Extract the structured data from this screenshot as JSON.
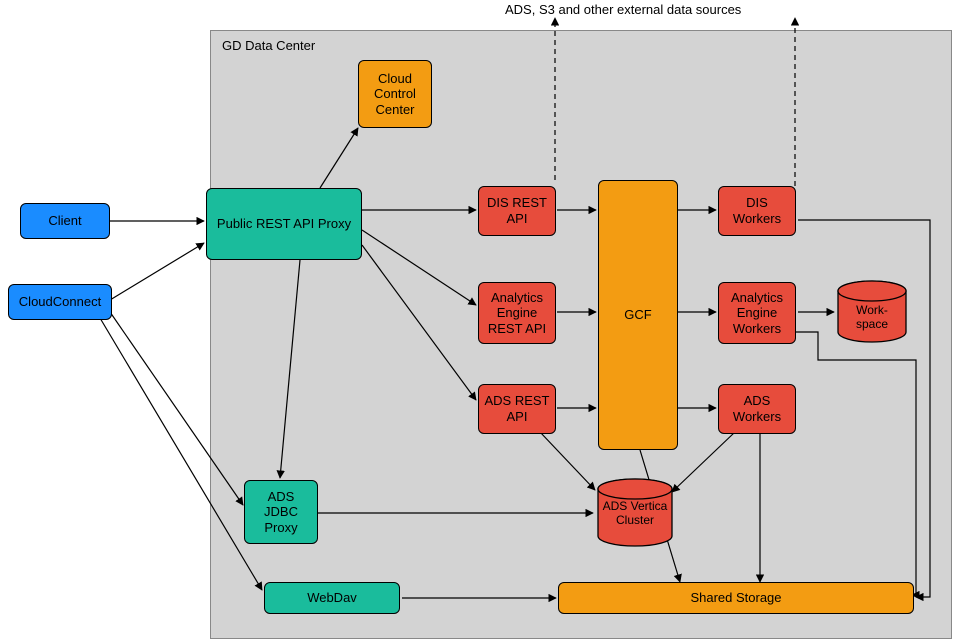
{
  "labels": {
    "external_sources": "ADS, S3 and other external data sources",
    "datacenter": "GD Data Center"
  },
  "nodes": {
    "client": "Client",
    "cloudconnect": "CloudConnect",
    "public_api": "Public REST API Proxy",
    "cloud_control": "Cloud Control Center",
    "dis_rest": "DIS REST API",
    "ae_rest": "Analytics Engine REST API",
    "ads_rest": "ADS REST API",
    "gcf": "GCF",
    "dis_workers": "DIS Workers",
    "ae_workers": "Analytics Engine Workers",
    "ads_workers": "ADS Workers",
    "workspace": "Work-\nspace",
    "ads_vertica": "ADS Vertica Cluster",
    "ads_jdbc": "ADS JDBC Proxy",
    "webdav": "WebDav",
    "shared_storage": "Shared Storage"
  },
  "colors": {
    "blue": "#1a8cff",
    "teal": "#1abc9c",
    "orange": "#f39c12",
    "red": "#e74c3c",
    "container_bg": "#d3d3d3",
    "container_border": "#888"
  }
}
